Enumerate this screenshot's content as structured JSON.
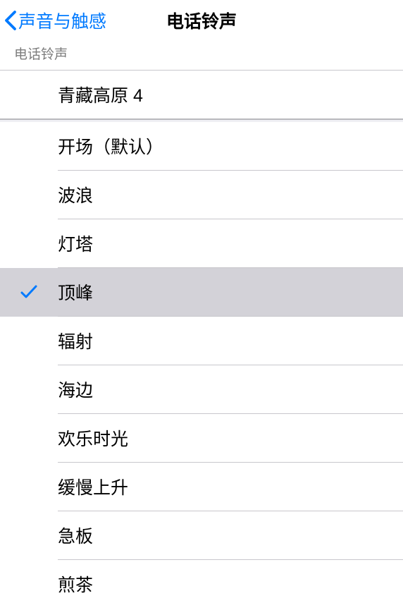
{
  "nav": {
    "back_label": "声音与触感",
    "title": "电话铃声"
  },
  "section": {
    "header": "电话铃声"
  },
  "custom_ringtones": [
    {
      "label": "青藏高原 4",
      "selected": false
    }
  ],
  "standard_ringtones": [
    {
      "label": "开场（默认）",
      "selected": false
    },
    {
      "label": "波浪",
      "selected": false
    },
    {
      "label": "灯塔",
      "selected": false
    },
    {
      "label": "顶峰",
      "selected": true
    },
    {
      "label": "辐射",
      "selected": false
    },
    {
      "label": "海边",
      "selected": false
    },
    {
      "label": "欢乐时光",
      "selected": false
    },
    {
      "label": "缓慢上升",
      "selected": false
    },
    {
      "label": "急板",
      "selected": false
    },
    {
      "label": "煎茶",
      "selected": false
    }
  ]
}
